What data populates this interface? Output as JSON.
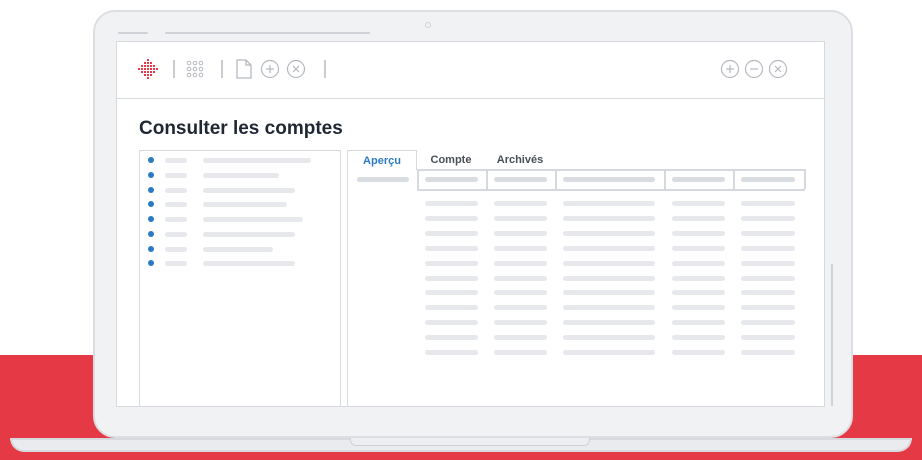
{
  "app": {
    "page_title": "Consulter les comptes"
  },
  "toolbar": {
    "left_icons": [
      "logo-diamond-icon",
      "grid-icon",
      "document-icon",
      "add-circle-icon",
      "close-circle-icon"
    ],
    "right_icons": [
      "add-circle-icon",
      "minus-circle-icon",
      "close-circle-icon"
    ],
    "logo_color": "#e63946"
  },
  "tabs": [
    {
      "label": "Aperçu",
      "active": true
    },
    {
      "label": "Compte",
      "active": false
    },
    {
      "label": "Archivés",
      "active": false
    }
  ],
  "left_list": {
    "item_count": 8,
    "bullet_color": "#2b7ac4"
  },
  "table": {
    "columns": 5,
    "rows": 11
  },
  "colors": {
    "accent": "#2b7ac4",
    "brand_red": "#e63946",
    "placeholder": "#e6e8eb"
  }
}
